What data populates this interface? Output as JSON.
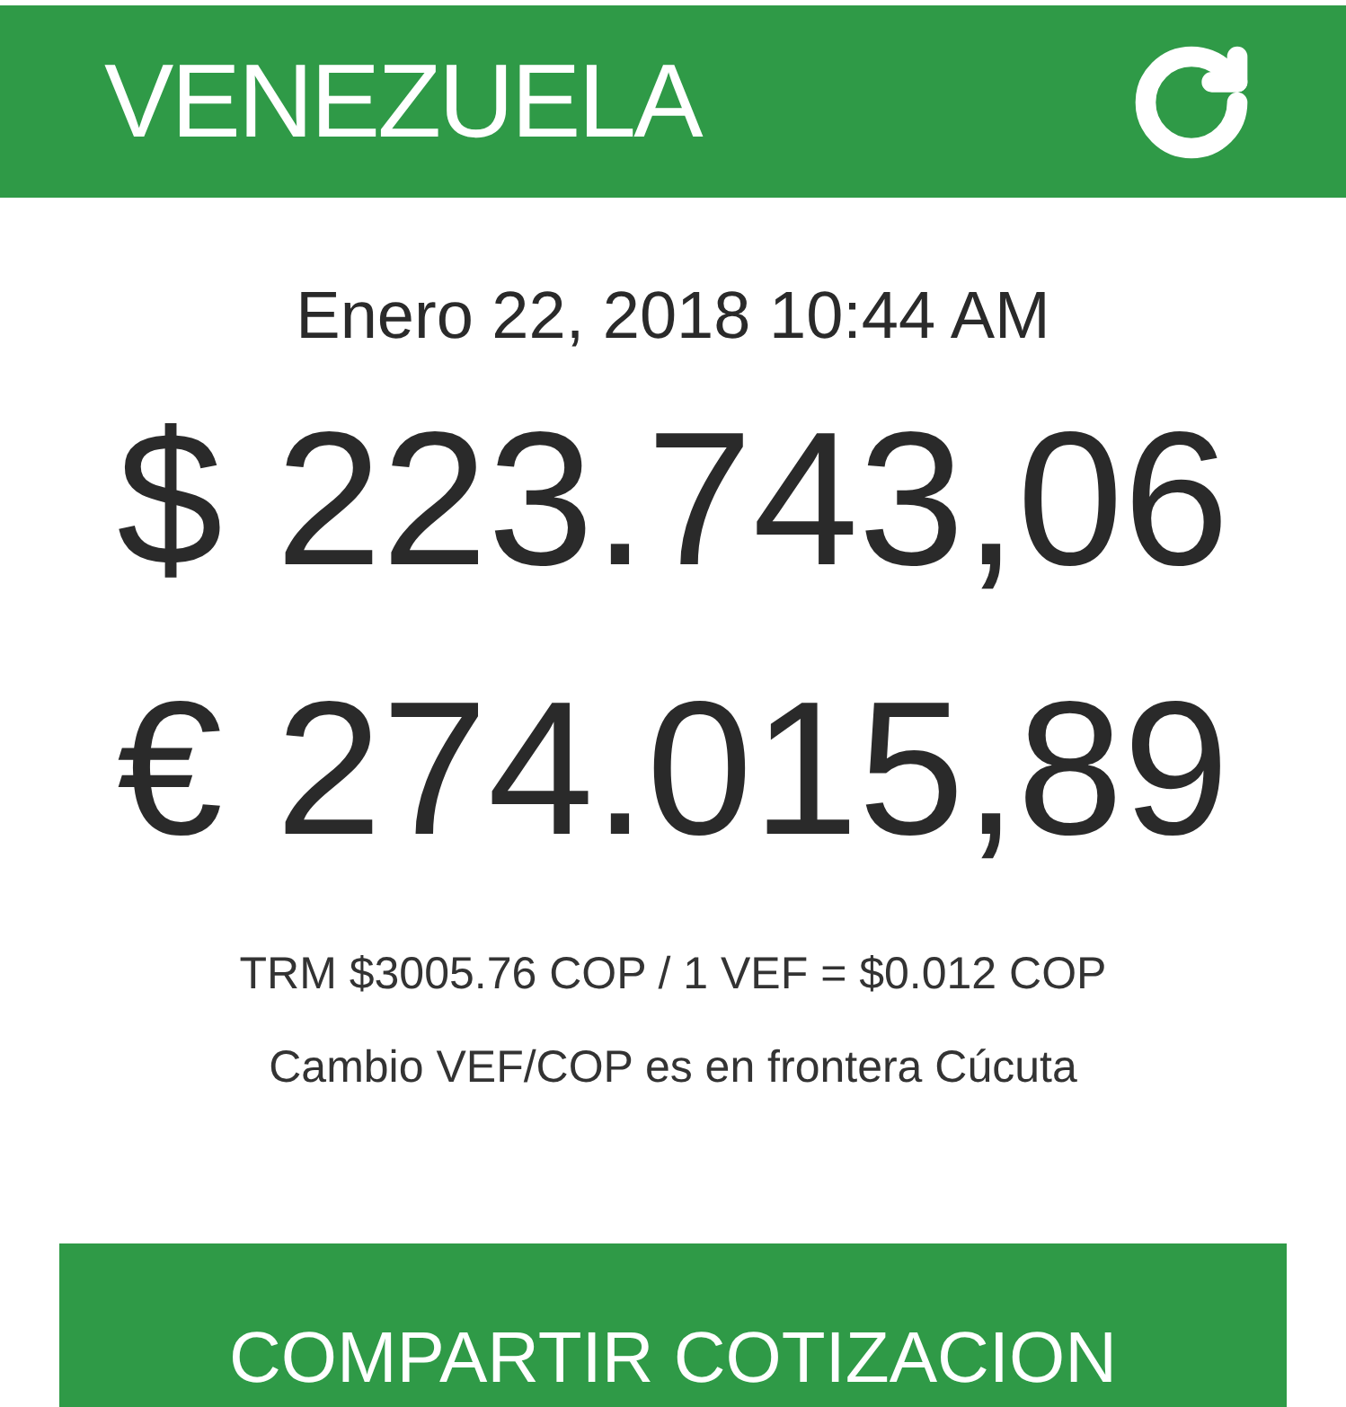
{
  "header": {
    "title": "VENEZUELA"
  },
  "date": "Enero 22, 2018 10:44 AM",
  "rates": [
    {
      "symbol": "$",
      "value": "223.743,06"
    },
    {
      "symbol": "€",
      "value": "274.015,89"
    }
  ],
  "notes": [
    "TRM $3005.76 COP / 1 VEF = $0.012 COP",
    "Cambio VEF/COP es en frontera Cúcuta"
  ],
  "share_button": {
    "label": "COMPARTIR COTIZACION"
  }
}
